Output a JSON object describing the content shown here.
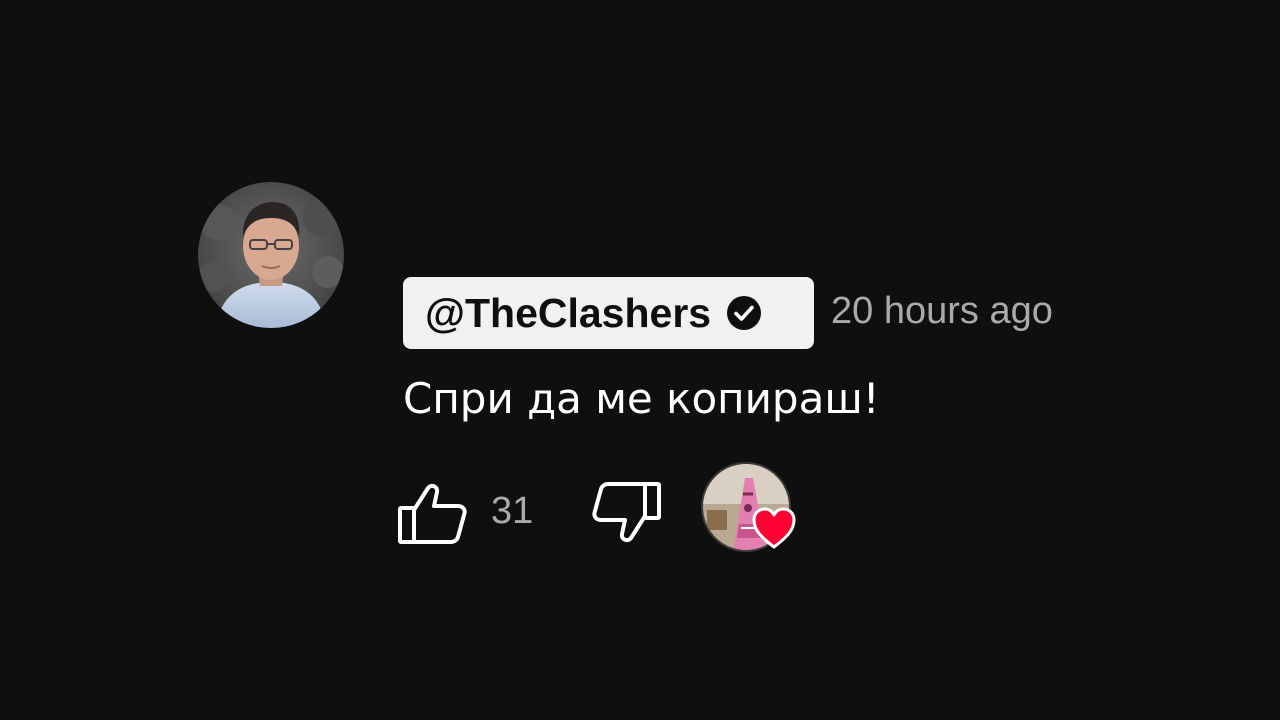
{
  "comment": {
    "author": "@TheClashers",
    "verified": true,
    "timestamp": "20 hours ago",
    "text": "Спри да ме копираш!",
    "like_count": "31",
    "hearted_by_creator": true
  },
  "icons": {
    "verified": "check-circle-icon",
    "like": "thumbs-up-icon",
    "dislike": "thumbs-down-icon",
    "heart": "heart-icon"
  },
  "colors": {
    "background": "#0f0f0f",
    "chip_background": "#f1f1f1",
    "secondary_text": "#aaaaaa",
    "heart": "#ff0033"
  }
}
